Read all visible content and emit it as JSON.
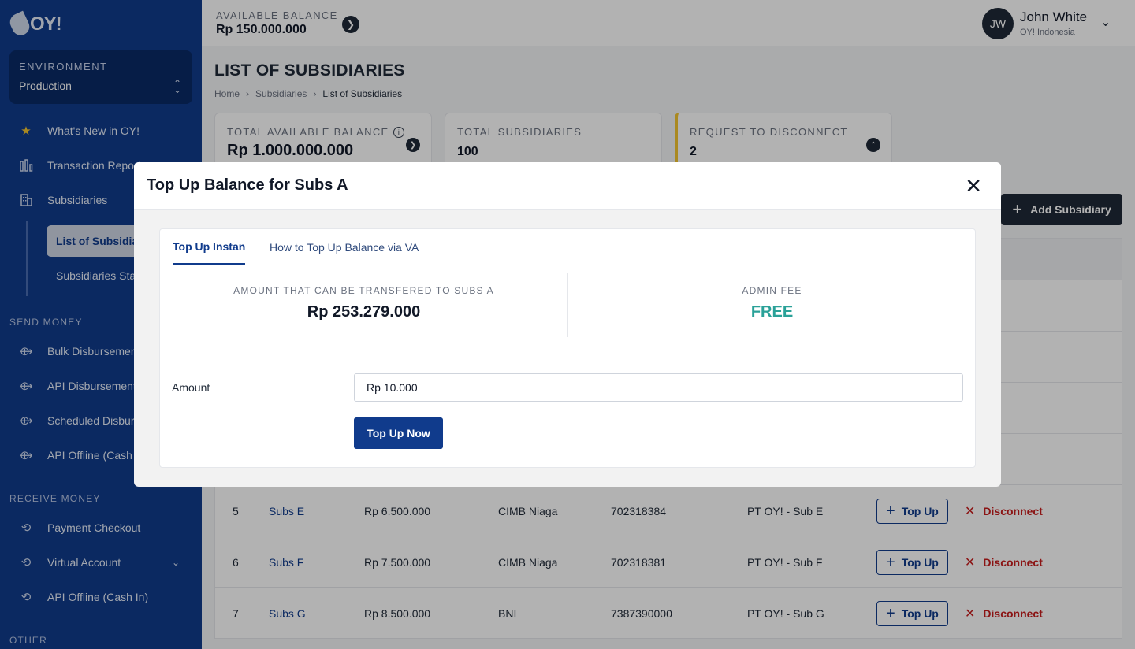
{
  "brand": {
    "logo_text": "OY!"
  },
  "sidebar": {
    "environment_label": "ENVIRONMENT",
    "environment_value": "Production",
    "items": {
      "whats_new": "What's New in OY!",
      "transaction_report": "Transaction Report",
      "subsidiaries": "Subsidiaries",
      "list_of_subsidiaries": "List of Subsidiaries",
      "subsidiaries_statement": "Subsidiaries Statement",
      "bulk_disbursement": "Bulk Disbursement",
      "api_disbursement": "API Disbursement",
      "scheduled_disbursement": "Scheduled Disbursement",
      "api_offline_cash_out": "API Offline (Cash Out)",
      "payment_checkout": "Payment Checkout",
      "virtual_account": "Virtual Account",
      "api_offline_cash_in": "API Offline (Cash In)"
    },
    "sections": {
      "send_money": "SEND MONEY",
      "receive_money": "RECEIVE MONEY",
      "other": "OTHER"
    }
  },
  "topbar": {
    "balance_label": "AVAILABLE BALANCE",
    "balance_value": "Rp 150.000.000",
    "user_initials": "JW",
    "user_name": "John White",
    "user_org": "OY! Indonesia"
  },
  "page": {
    "title": "LIST OF SUBSIDIARIES",
    "breadcrumb": [
      "Home",
      "Subsidiaries",
      "List of Subsidiaries"
    ]
  },
  "stats": {
    "total_available_balance_label": "TOTAL AVAILABLE BALANCE",
    "total_available_balance_value": "Rp 1.000.000.000",
    "total_subsidiaries_label": "TOTAL SUBSIDIARIES",
    "total_subsidiaries_value": "100",
    "request_disconnect_label": "REQUEST TO DISCONNECT",
    "request_disconnect_value": "2"
  },
  "actions": {
    "add_subsidiary": "Add Subsidiary"
  },
  "table": {
    "topup_label": "Top Up",
    "disconnect_label": "Disconnect",
    "rows": [
      {
        "no": "5",
        "name": "Subs E",
        "balance": "Rp 6.500.000",
        "bank": "CIMB Niaga",
        "account": "702318384",
        "entity": "PT OY!  - Sub E"
      },
      {
        "no": "6",
        "name": "Subs F",
        "balance": "Rp 7.500.000",
        "bank": "CIMB Niaga",
        "account": "702318381",
        "entity": "PT OY!  - Sub F"
      },
      {
        "no": "7",
        "name": "Subs G",
        "balance": "Rp 8.500.000",
        "bank": "BNI",
        "account": "7387390000",
        "entity": "PT OY!  - Sub G"
      }
    ]
  },
  "modal": {
    "title": "Top Up Balance for Subs A",
    "tabs": [
      "Top Up Instan",
      "How to Top Up Balance via VA"
    ],
    "transferable_label": "AMOUNT THAT CAN BE TRANSFERED TO SUBS A",
    "transferable_value": "Rp 253.279.000",
    "admin_fee_label": "ADMIN FEE",
    "admin_fee_value": "FREE",
    "amount_label": "Amount",
    "amount_value": "Rp 10.000",
    "submit_label": "Top Up Now"
  },
  "colors": {
    "sidebar": "#103b8c",
    "primary": "#103b8c",
    "danger": "#c81e1e",
    "free": "#2aa198",
    "warning": "#f4c430"
  }
}
